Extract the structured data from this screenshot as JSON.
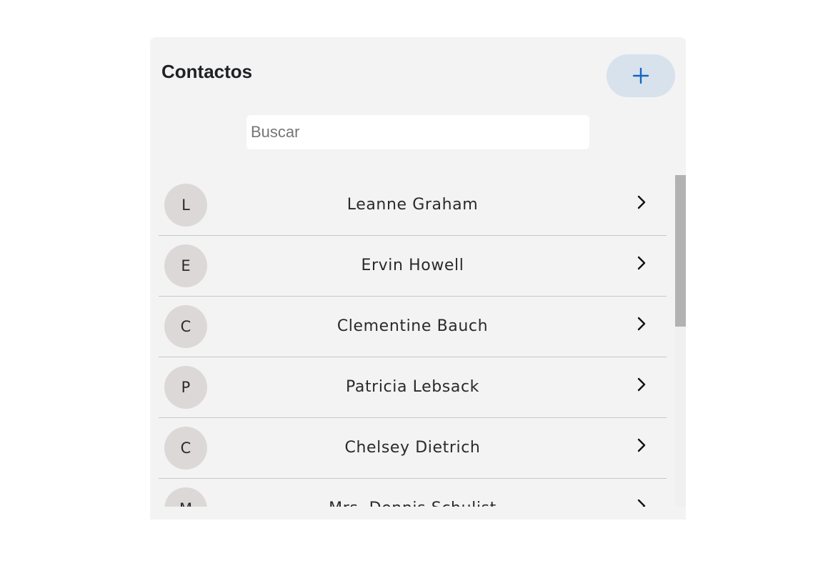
{
  "header": {
    "title": "Contactos",
    "add_label": "+"
  },
  "search": {
    "placeholder": "Buscar",
    "value": ""
  },
  "contacts": [
    {
      "initial": "L",
      "name": "Leanne Graham"
    },
    {
      "initial": "E",
      "name": "Ervin Howell"
    },
    {
      "initial": "C",
      "name": "Clementine Bauch"
    },
    {
      "initial": "P",
      "name": "Patricia Lebsack"
    },
    {
      "initial": "C",
      "name": "Chelsey Dietrich"
    },
    {
      "initial": "M",
      "name": "Mrs. Dennis Schulist"
    }
  ],
  "icons": {
    "add": "plus-icon",
    "row_action": "chevron-right-icon"
  },
  "colors": {
    "panel_bg": "#f3f3f3",
    "add_button_bg": "#d8e2ec",
    "add_icon": "#1565c0",
    "avatar_bg": "#ddd8d8",
    "divider": "#c8c8c8",
    "scroll_thumb": "#b2b2b2"
  }
}
